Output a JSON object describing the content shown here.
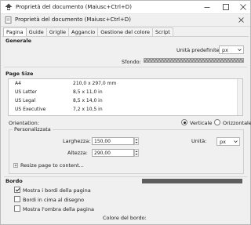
{
  "window": {
    "title": "Proprietà del documento (Maiusc+Ctrl+D)"
  },
  "panel": {
    "title": "Proprietà del documento (Maiusc+Ctrl+D)"
  },
  "tabs": [
    {
      "label": "Pagina"
    },
    {
      "label": "Guide"
    },
    {
      "label": "Griglie"
    },
    {
      "label": "Aggancio"
    },
    {
      "label": "Gestione del colore"
    },
    {
      "label": "Script"
    }
  ],
  "general": {
    "heading": "Generale",
    "unit_label": "Unità predefinite:",
    "unit_value": "px",
    "background_label": "Sfondo:"
  },
  "page_size": {
    "heading": "Page Size",
    "sizes": [
      {
        "name": "A4",
        "dims": "210,0 x 297,0 mm"
      },
      {
        "name": "US Letter",
        "dims": "8,5 x 11,0 in"
      },
      {
        "name": "US Legal",
        "dims": "8,5 x 14,0 in"
      },
      {
        "name": "US Executive",
        "dims": "7,2 x 10,5 in"
      }
    ],
    "orientation_label": "Orientation:",
    "vertical_label": "Verticale",
    "horizontal_label": "Orizzontale",
    "orientation_selected": "Verticale"
  },
  "custom": {
    "group_title": "Personalizzata",
    "width_label": "Larghezza:",
    "width_value": "150,00",
    "height_label": "Altezza:",
    "height_value": "290,00",
    "unit_label": "Unità:",
    "unit_value": "px",
    "resize_label": "Resize page to content..."
  },
  "border": {
    "heading": "Bordo",
    "show_border_label": "Mostra i bordi della pagina",
    "show_border_checked": true,
    "border_on_top_label": "Bordi in cima al disegno",
    "border_on_top_checked": false,
    "show_shadow_label": "Mostra l'ombra della pagina",
    "show_shadow_checked": false,
    "border_color_label": "Colore del bordo:",
    "border_color": "#5e5e5e"
  }
}
